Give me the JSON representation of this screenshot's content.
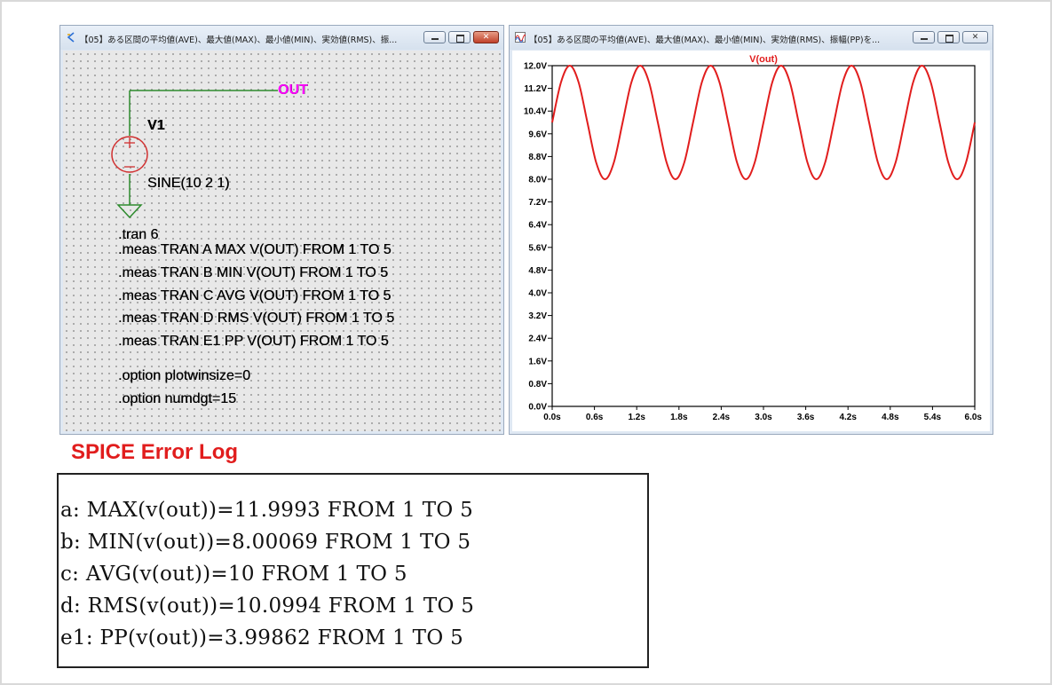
{
  "schematic_window": {
    "title": "【05】ある区間の平均値(AVE)、最大値(MAX)、最小値(MIN)、実効値(RMS)、振...",
    "icon": "ltspice-schematic-icon",
    "net_label": "OUT",
    "component_name": "V1",
    "component_value": "SINE(10 2 1)",
    "directives": [
      ".tran 6",
      ".meas TRAN A MAX V(OUT) FROM 1 TO 5",
      ".meas TRAN B MIN V(OUT) FROM 1 TO 5",
      ".meas TRAN C AVG V(OUT) FROM 1 TO 5",
      ".meas TRAN D RMS V(OUT) FROM 1 TO 5",
      ".meas TRAN E1 PP V(OUT) FROM 1 TO 5"
    ],
    "options": [
      ".option plotwinsize=0",
      ".option numdgt=15"
    ],
    "colors": {
      "wire": "#2e8b2e",
      "component": "#d03030",
      "net_label": "#ff00ff"
    }
  },
  "plot_window": {
    "title": "【05】ある区間の平均値(AVE)、最大値(MAX)、最小値(MIN)、実効値(RMS)、振幅(PP)を...",
    "icon": "ltspice-waveform-icon"
  },
  "chart_data": {
    "type": "line",
    "title": "V(out)",
    "xlabel": "",
    "ylabel": "",
    "xlim": [
      0,
      6
    ],
    "ylim": [
      0,
      12
    ],
    "x_ticks": [
      "0.0s",
      "0.6s",
      "1.2s",
      "1.8s",
      "2.4s",
      "3.0s",
      "3.6s",
      "4.2s",
      "4.8s",
      "5.4s",
      "6.0s"
    ],
    "y_ticks": [
      "0.0V",
      "0.8V",
      "1.6V",
      "2.4V",
      "3.2V",
      "4.0V",
      "4.8V",
      "5.6V",
      "6.4V",
      "7.2V",
      "8.0V",
      "8.8V",
      "9.6V",
      "10.4V",
      "11.2V",
      "12.0V"
    ],
    "grid": false,
    "series": [
      {
        "name": "V(out)",
        "color": "#e11d1d",
        "x": [
          0,
          0.125,
          0.25,
          0.375,
          0.5,
          0.625,
          0.75,
          0.875,
          1,
          1.125,
          1.25,
          1.375,
          1.5,
          1.625,
          1.75,
          1.875,
          2,
          2.125,
          2.25,
          2.375,
          2.5,
          2.625,
          2.75,
          2.875,
          3,
          3.125,
          3.25,
          3.375,
          3.5,
          3.625,
          3.75,
          3.875,
          4,
          4.125,
          4.25,
          4.375,
          4.5,
          4.625,
          4.75,
          4.875,
          5,
          5.125,
          5.25,
          5.375,
          5.5,
          5.625,
          5.75,
          5.875,
          6
        ],
        "y": [
          10,
          11.414,
          12,
          11.414,
          10,
          8.586,
          8,
          8.586,
          10,
          11.414,
          12,
          11.414,
          10,
          8.586,
          8,
          8.586,
          10,
          11.414,
          12,
          11.414,
          10,
          8.586,
          8,
          8.586,
          10,
          11.414,
          12,
          11.414,
          10,
          8.586,
          8,
          8.586,
          10,
          11.414,
          12,
          11.414,
          10,
          8.586,
          8,
          8.586,
          10,
          11.414,
          12,
          11.414,
          10,
          8.586,
          8,
          8.586,
          10
        ]
      }
    ]
  },
  "error_log": {
    "title": "SPICE Error Log",
    "lines": [
      "a: MAX(v(out))=11.9993 FROM 1 TO 5",
      "b: MIN(v(out))=8.00069 FROM 1 TO 5",
      "c: AVG(v(out))=10 FROM 1 TO 5",
      "d: RMS(v(out))=10.0994 FROM 1 TO 5",
      "e1: PP(v(out))=3.99862 FROM 1 TO 5"
    ]
  }
}
